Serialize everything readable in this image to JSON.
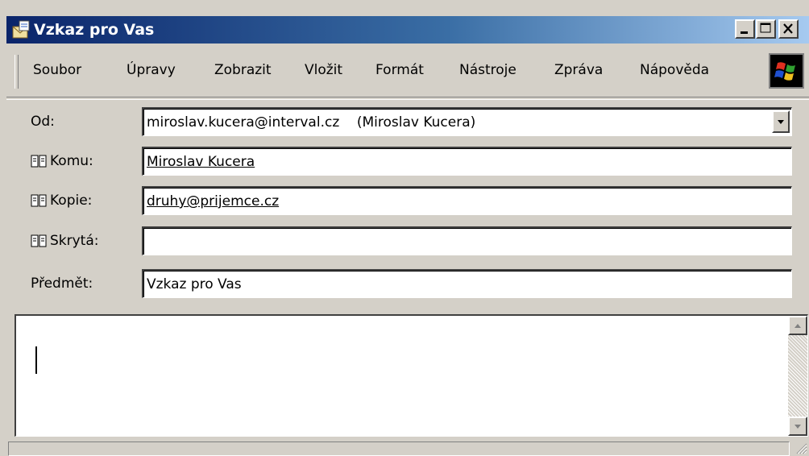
{
  "window": {
    "title": "Vzkaz pro Vas"
  },
  "menu": {
    "items": [
      {
        "label": "Soubor"
      },
      {
        "label": "Úpravy"
      },
      {
        "label": "Zobrazit"
      },
      {
        "label": "Vložit"
      },
      {
        "label": "Formát"
      },
      {
        "label": "Nástroje"
      },
      {
        "label": "Zpráva"
      },
      {
        "label": "Nápověda"
      }
    ]
  },
  "form": {
    "from": {
      "label": "Od:",
      "value": "miroslav.kucera@interval.cz    (Miroslav Kucera)"
    },
    "to": {
      "label": "Komu:",
      "value": "Miroslav Kucera"
    },
    "cc": {
      "label": "Kopie:",
      "value": "druhy@prijemce.cz"
    },
    "bcc": {
      "label": "Skrytá:",
      "value": ""
    },
    "subject": {
      "label": "Předmět:",
      "value": "Vzkaz pro Vas"
    }
  },
  "editor": {
    "content": ""
  },
  "icons": {
    "title": "envelope-icon",
    "address_book": "address-book-icon",
    "windows_logo": "windows-logo-icon"
  },
  "colors": {
    "titlebar_start": "#0a246a",
    "titlebar_end": "#a6caf0",
    "chrome": "#d4d0c8"
  }
}
